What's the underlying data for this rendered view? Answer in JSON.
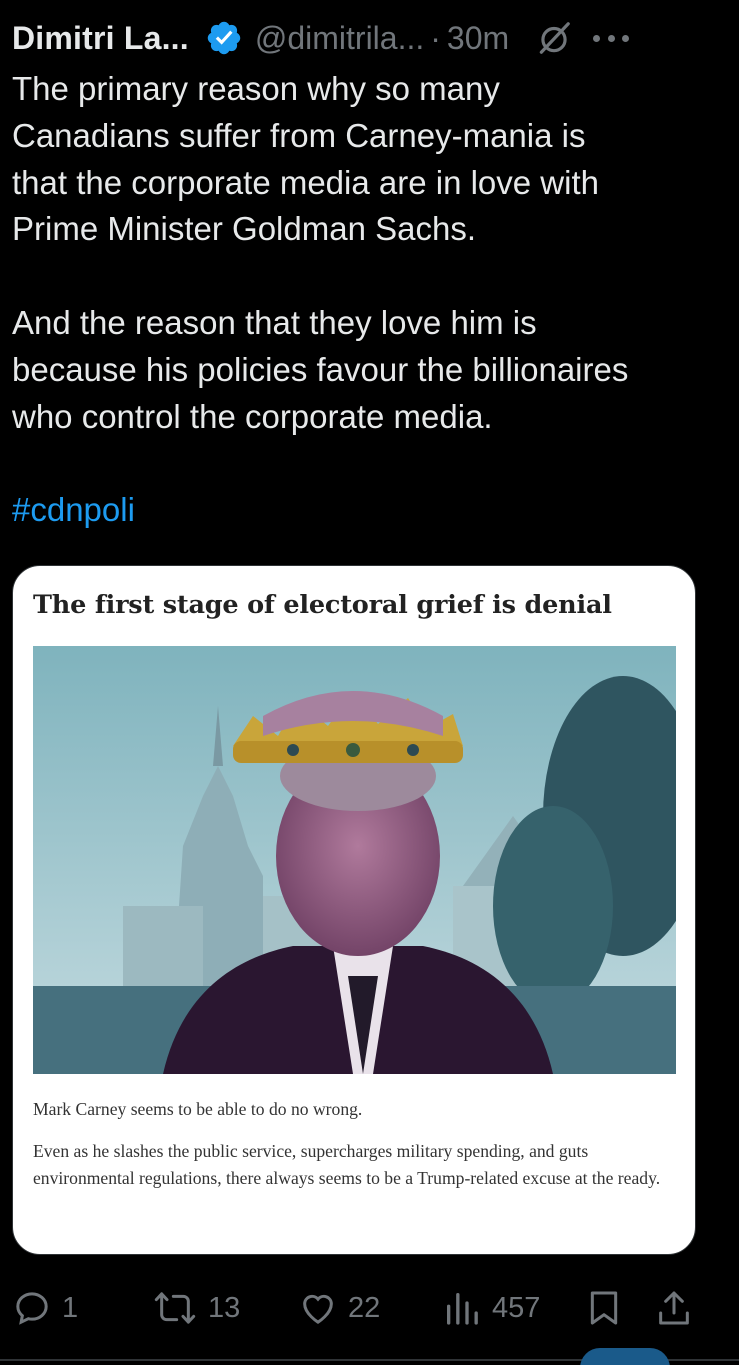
{
  "tweet": {
    "author_name": "Dimitri La...",
    "handle": "@dimitrila...",
    "separator": "·",
    "time": "30m",
    "text_p1": "The primary reason why so many\nCanadians suffer from Carney-mania is\nthat the corporate media are in love with\nPrime Minister Goldman Sachs.",
    "text_p2": "And the reason that they love him is\nbecause his policies favour the billionaires\nwho control the corporate media.",
    "hashtag": "#cdnpoli"
  },
  "card": {
    "title": "The first stage of electoral grief is denial",
    "body_p1": "Mark Carney seems to be able to do no wrong.",
    "body_p2": "Even as he slashes the public service, supercharges military spending, and guts environmental regulations, there always seems to be a Trump-related excuse at the ready."
  },
  "actions": {
    "replies": "1",
    "reposts": "13",
    "likes": "22",
    "views": "457"
  },
  "icons": {
    "verified": "verified-badge-icon",
    "grok": "grok-icon",
    "more": "more-icon",
    "reply": "reply-icon",
    "repost": "repost-icon",
    "like": "heart-icon",
    "views": "views-icon",
    "bookmark": "bookmark-icon",
    "share": "share-icon"
  },
  "colors": {
    "background": "#000000",
    "text": "#e7e9ea",
    "muted": "#71767b",
    "accent": "#1d9bf0"
  }
}
